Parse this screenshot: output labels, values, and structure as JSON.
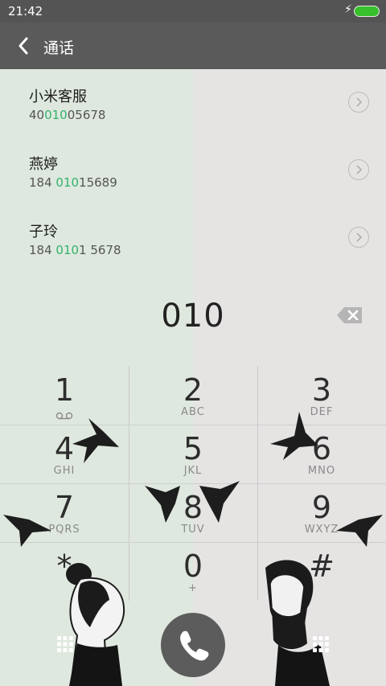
{
  "status_bar": {
    "time": "21:42"
  },
  "header": {
    "title": "通话"
  },
  "contacts": [
    {
      "name": "小米客服",
      "num_pre": "40",
      "num_hl": "010",
      "num_post": "05678"
    },
    {
      "name": "燕婷",
      "num_pre": "184 ",
      "num_hl": "010",
      "num_post": "15689"
    },
    {
      "name": "子玲",
      "num_pre": "184 ",
      "num_hl": "010",
      "num_post": "1 5678"
    }
  ],
  "dialer": {
    "input": "010"
  },
  "keys": [
    {
      "digit": "1",
      "letters": ""
    },
    {
      "digit": "2",
      "letters": "ABC"
    },
    {
      "digit": "3",
      "letters": "DEF"
    },
    {
      "digit": "4",
      "letters": "GHI"
    },
    {
      "digit": "5",
      "letters": "JKL"
    },
    {
      "digit": "6",
      "letters": "MNO"
    },
    {
      "digit": "7",
      "letters": "PQRS"
    },
    {
      "digit": "8",
      "letters": "TUV"
    },
    {
      "digit": "9",
      "letters": "WXYZ"
    },
    {
      "digit": "*",
      "letters": ""
    },
    {
      "digit": "0",
      "letters": "+"
    },
    {
      "digit": "#",
      "letters": ""
    }
  ],
  "icons": {
    "back": "chevron-left-icon",
    "contact_detail": "chevron-right-circle-icon",
    "backspace": "backspace-icon",
    "call": "phone-icon",
    "dialpad_toggle": "dialpad-icon",
    "voicemail": "voicemail-icon"
  },
  "colors": {
    "highlight": "#33b36d",
    "header": "#5a5a5a",
    "call_button": "#5c5c5c"
  }
}
